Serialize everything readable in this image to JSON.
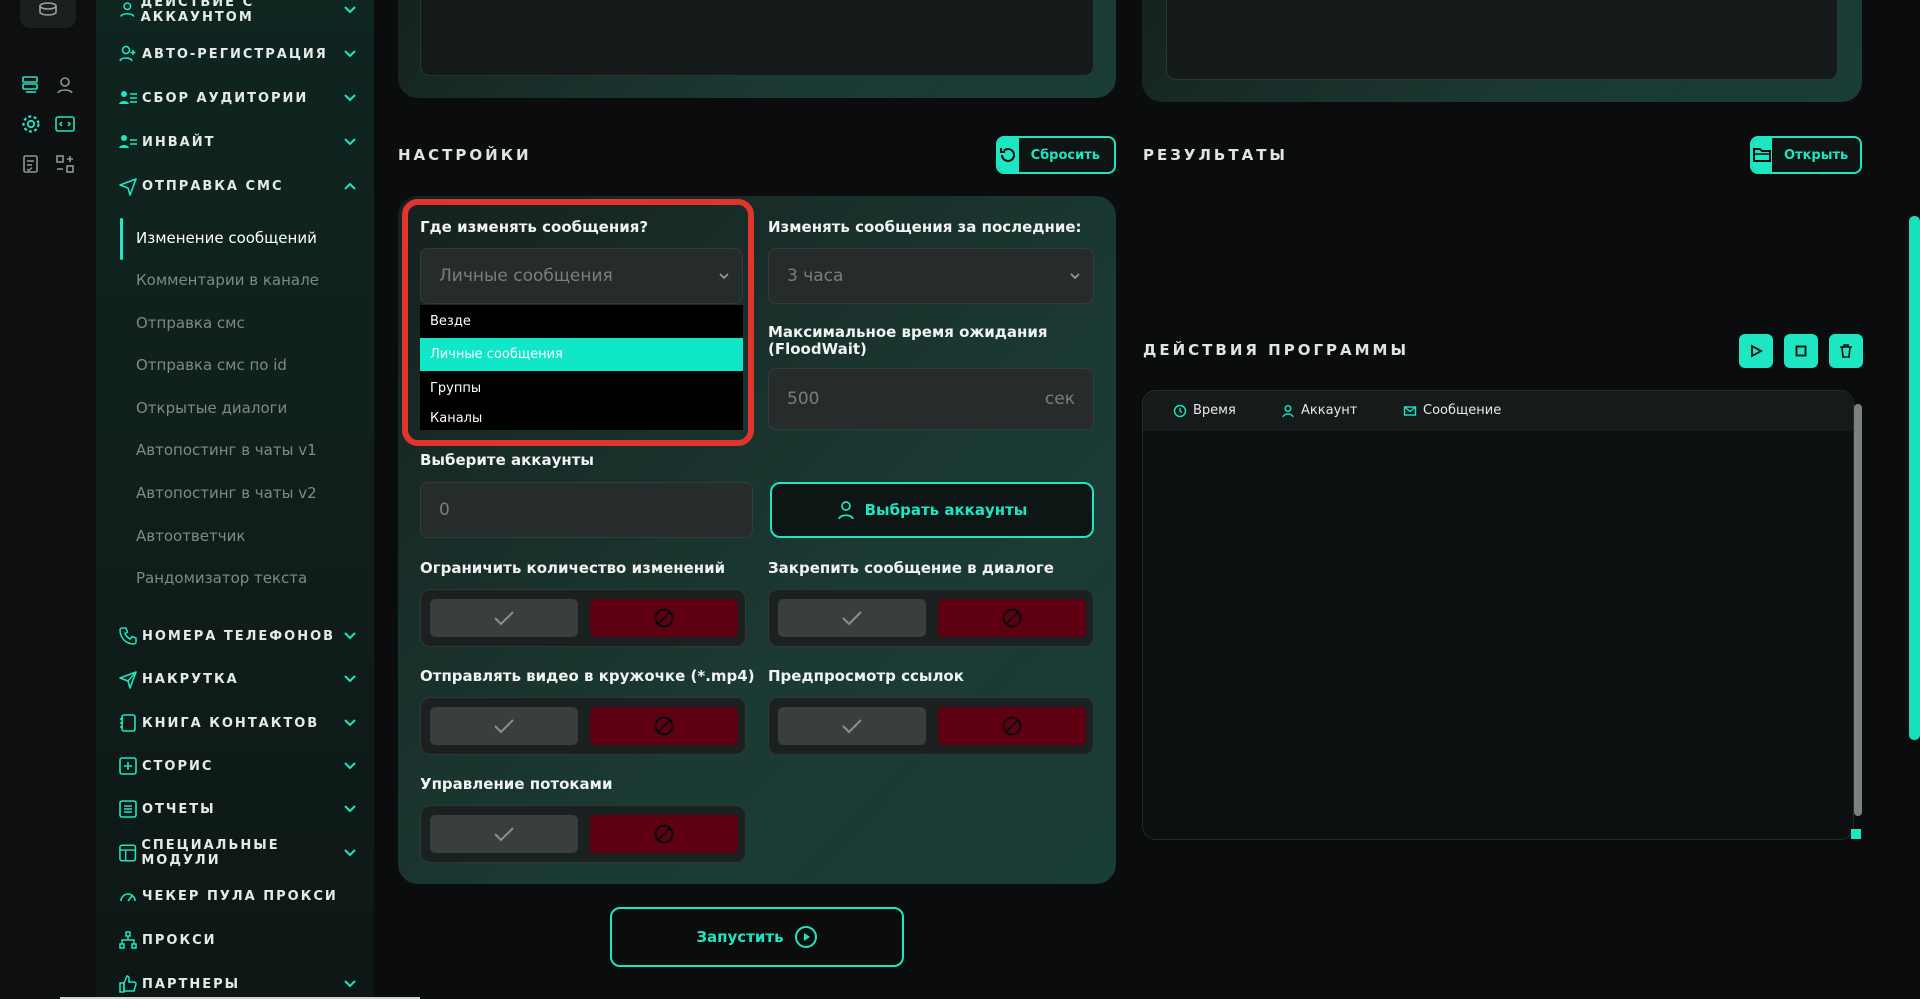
{
  "sidebar": {
    "sections_top": [
      {
        "label": "ДЕЙСТВИЕ С АККАУНТОМ"
      },
      {
        "label": "АВТО-РЕГИСТРАЦИЯ"
      },
      {
        "label": "СБОР АУДИТОРИИ"
      },
      {
        "label": "ИНВАЙТ"
      },
      {
        "label": "ОТПРАВКА СМС"
      }
    ],
    "sub_items": [
      {
        "label": "Изменение сообщений",
        "active": true
      },
      {
        "label": "Комментарии в канале"
      },
      {
        "label": "Отправка смс"
      },
      {
        "label": "Отправка смс по id"
      },
      {
        "label": "Открытые диалоги"
      },
      {
        "label": "Автопостинг в чаты v1"
      },
      {
        "label": "Автопостинг в чаты v2"
      },
      {
        "label": "Автоответчик"
      },
      {
        "label": "Рандомизатор текста"
      }
    ],
    "sections_bottom": [
      {
        "label": "НОМЕРА ТЕЛЕФОНОВ"
      },
      {
        "label": "НАКРУТКА"
      },
      {
        "label": "КНИГА КОНТАКТОВ"
      },
      {
        "label": "СТОРИС"
      },
      {
        "label": "ОТЧЕТЫ"
      },
      {
        "label": "СПЕЦИАЛЬНЫЕ МОДУЛИ"
      },
      {
        "label": "ЧЕКЕР ПУЛА ПРОКСИ"
      },
      {
        "label": "ПРОКСИ"
      },
      {
        "label": "ПАРТНЕРЫ"
      }
    ]
  },
  "settings": {
    "title": "НАСТРОЙКИ",
    "reset_label": "Сбросить",
    "where_label": "Где изменять сообщения?",
    "where_value": "Личные сообщения",
    "where_options": [
      "Везде",
      "Личные сообщения",
      "Группы",
      "Каналы"
    ],
    "period_label": "Изменять сообщения за последние:",
    "period_value": "3 часа",
    "floodwait_label": "Максимальное время ожидания (FloodWait)",
    "floodwait_value": "500",
    "floodwait_unit": "сек",
    "accounts_label": "Выберите аккаунты",
    "accounts_value": "0",
    "choose_accounts_label": "Выбрать аккаунты",
    "limit_label": "Ограничить количество изменений",
    "pin_label": "Закрепить сообщение в диалоге",
    "video_label": "Отправлять видео в кружочке (*.mp4)",
    "preview_label": "Предпросмотр ссылок",
    "threads_label": "Управление потоками",
    "run_label": "Запустить"
  },
  "results": {
    "title": "РЕЗУЛЬТАТЫ",
    "open_label": "Открыть"
  },
  "actions": {
    "title": "ДЕЙСТВИЯ ПРОГРАММЫ",
    "col_time": "Время",
    "col_account": "Аккаунт",
    "col_message": "Сообщение"
  },
  "colors": {
    "accent": "#1ee6c3",
    "danger": "#5e0012",
    "highlight": "#e0352c"
  }
}
